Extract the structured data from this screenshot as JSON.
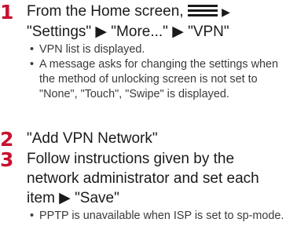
{
  "steps": [
    {
      "number": "1",
      "title_line1": "From the Home screen,",
      "menu_icon": "hamburger-menu-icon",
      "arrow": "▶",
      "title_line2": "\"Settings\" ▶ \"More...\" ▶ \"VPN\"",
      "notes": [
        "VPN list is displayed.",
        "A message asks for changing the settings when the method of unlocking screen is not set to \"None\", \"Touch\", \"Swipe\" is displayed."
      ]
    },
    {
      "number": "2",
      "title": "\"Add VPN Network\""
    },
    {
      "number": "3",
      "title": "Follow instructions given by the network administrator and set each item ▶ \"Save\"",
      "notes": [
        "PPTP is unavailable when ISP is set to sp-mode."
      ]
    }
  ],
  "bullet_char": "•",
  "colors": {
    "step_number": "#c8102e",
    "text": "#1a1a1a",
    "note_text": "#3a3a3a"
  }
}
